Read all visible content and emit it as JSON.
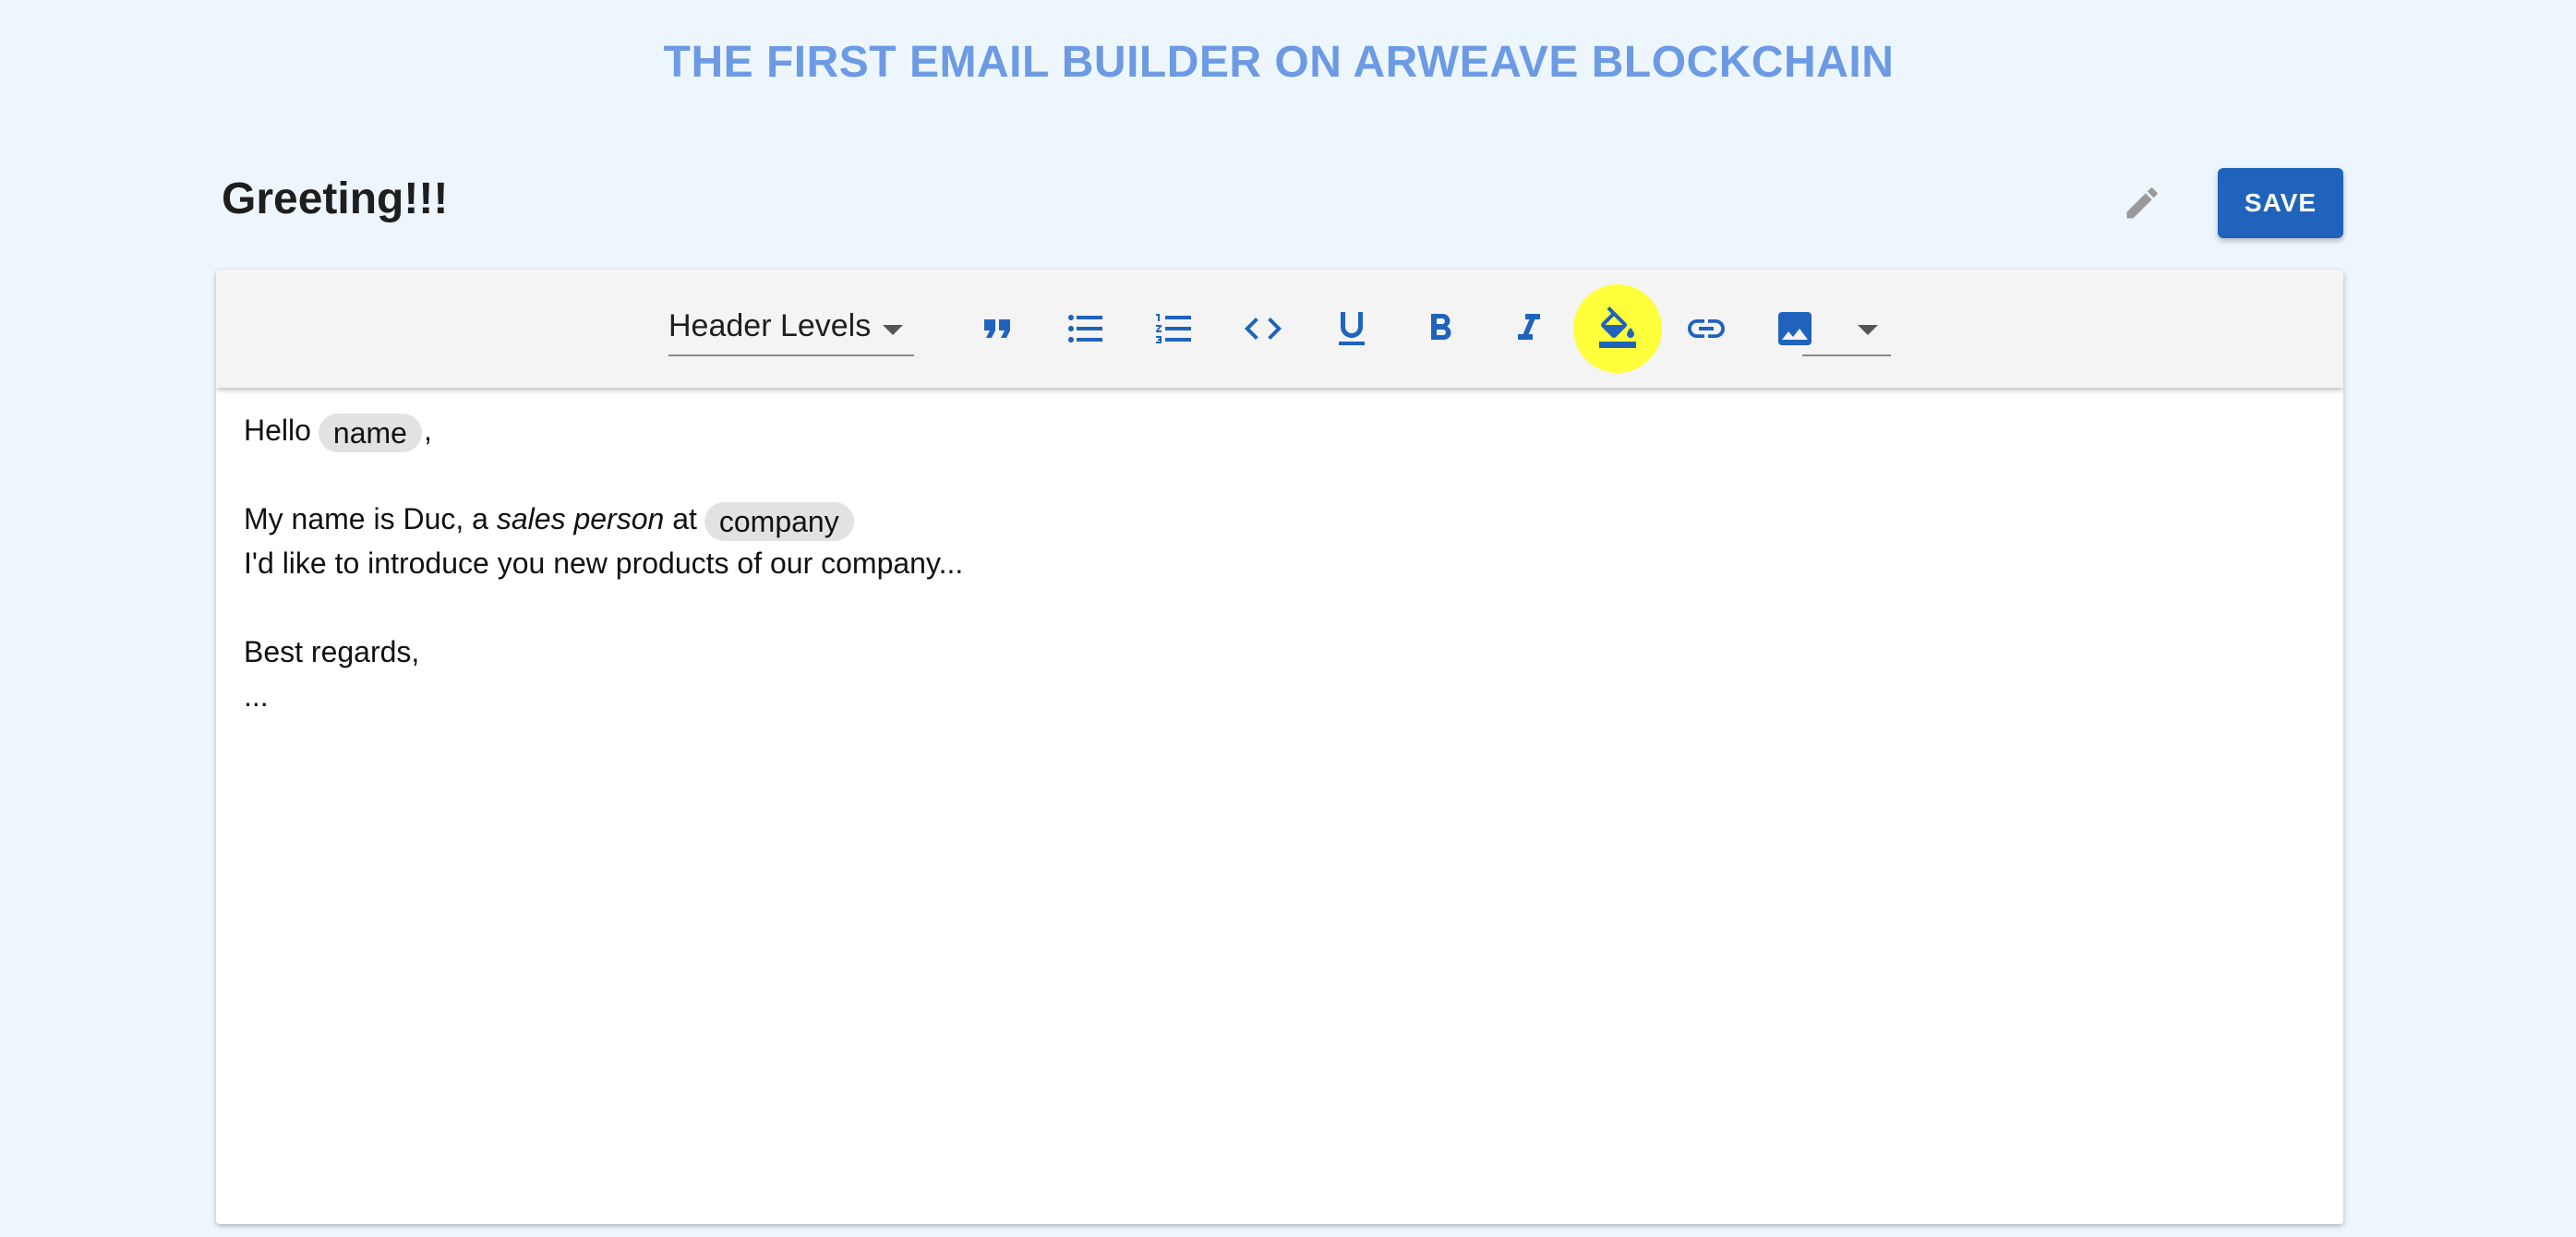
{
  "app": {
    "title": "THE FIRST EMAIL BUILDER ON ARWEAVE BLOCKCHAIN"
  },
  "document": {
    "title": "Greeting!!!",
    "save_label": "SAVE",
    "edit_icon": "pencil-icon"
  },
  "toolbar": {
    "header_select_label": "Header Levels",
    "font_size_value": "",
    "active_tool": "highlight-color",
    "highlight_color": "#ffff3b",
    "icon_color": "#1f63bc",
    "tools": [
      {
        "name": "blockquote",
        "icon": "quote-icon"
      },
      {
        "name": "bulleted-list",
        "icon": "bulleted-list-icon"
      },
      {
        "name": "numbered-list",
        "icon": "numbered-list-icon"
      },
      {
        "name": "code",
        "icon": "code-icon"
      },
      {
        "name": "underline",
        "icon": "underline-icon"
      },
      {
        "name": "bold",
        "icon": "bold-icon"
      },
      {
        "name": "italic",
        "icon": "italic-icon"
      },
      {
        "name": "highlight-color",
        "icon": "paint-bucket-icon"
      },
      {
        "name": "link",
        "icon": "link-icon"
      },
      {
        "name": "image",
        "icon": "image-icon"
      }
    ]
  },
  "editor": {
    "line1": {
      "text_before": "Hello",
      "variable": "name",
      "text_after": ","
    },
    "line2": {
      "text_before": "My name is Duc, a ",
      "italic_text": "sales person",
      "text_middle": " at",
      "variable": "company"
    },
    "line3": "I'd like to introduce you new products of our company...",
    "line4": "Best regards,",
    "line5": "..."
  },
  "colors": {
    "background": "#eef6fd",
    "title": "#6c9ae4",
    "accent": "#1f63bc",
    "chip": "#e2e2e2"
  }
}
